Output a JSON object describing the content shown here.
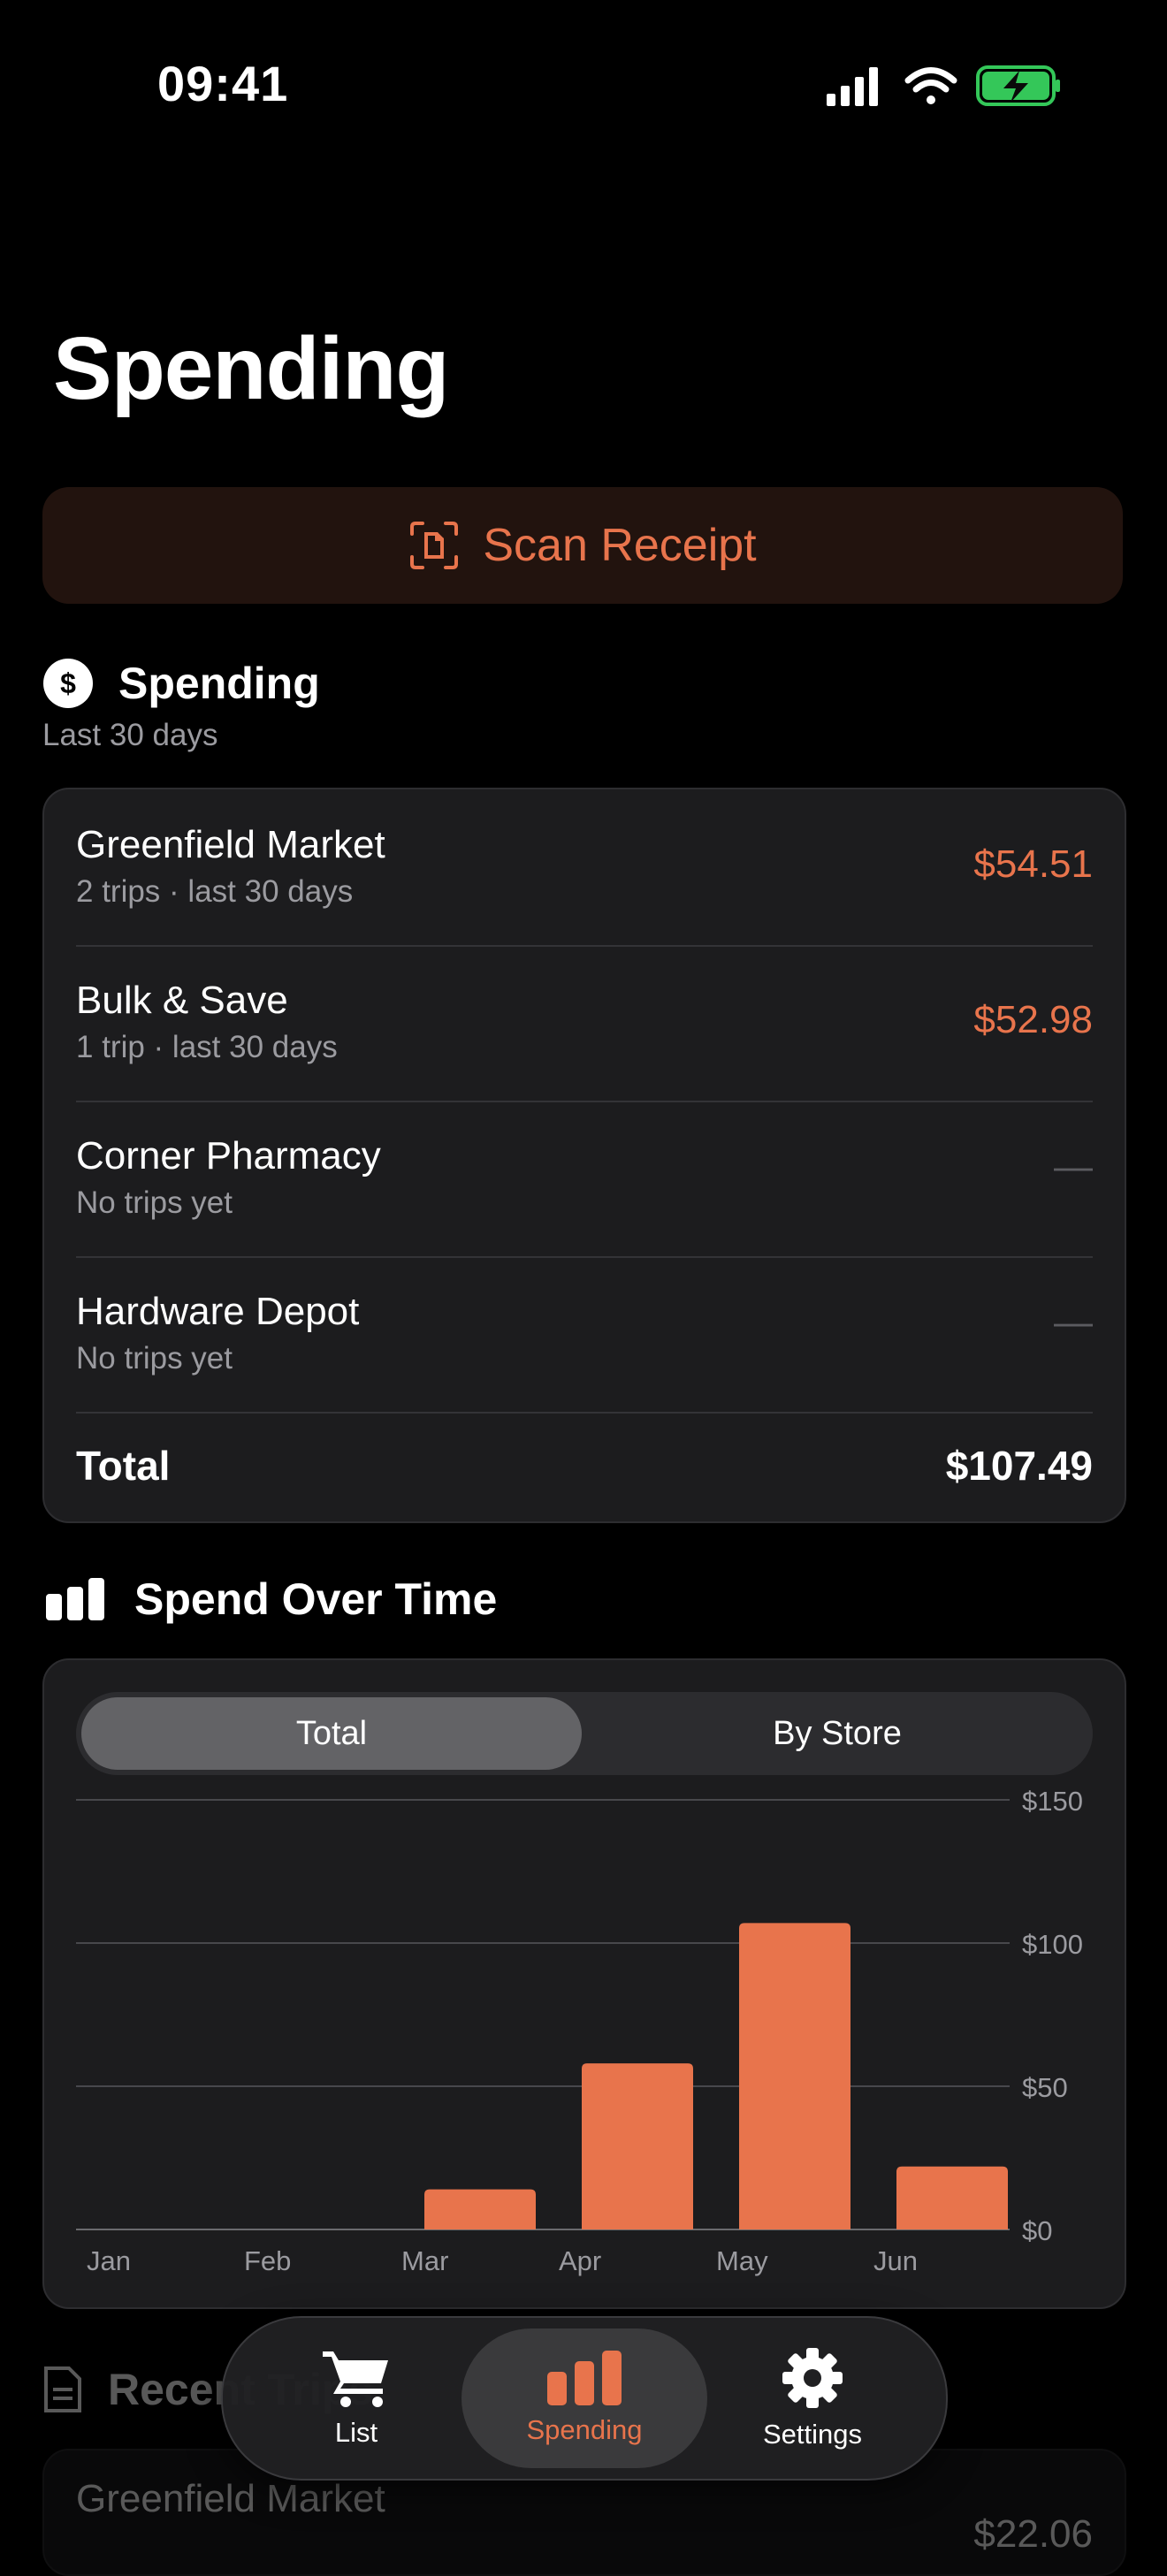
{
  "status_bar": {
    "time": "09:41"
  },
  "page": {
    "title": "Spending"
  },
  "scan": {
    "label": "Scan Receipt"
  },
  "spending_section": {
    "title": "Spending",
    "subtitle": "Last 30 days"
  },
  "stores": [
    {
      "name": "Greenfield Market",
      "meta": "2 trips · last 30 days",
      "amount": "$54.51"
    },
    {
      "name": "Bulk & Save",
      "meta": "1 trip · last 30 days",
      "amount": "$52.98"
    },
    {
      "name": "Corner Pharmacy",
      "meta": "No trips yet",
      "amount": "—"
    },
    {
      "name": "Hardware Depot",
      "meta": "No trips yet",
      "amount": "—"
    }
  ],
  "total": {
    "label": "Total",
    "amount": "$107.49"
  },
  "chart_section": {
    "title": "Spend Over Time",
    "segments": [
      {
        "label": "Total",
        "selected": true
      },
      {
        "label": "By Store",
        "selected": false
      }
    ]
  },
  "chart_data": {
    "type": "bar",
    "categories": [
      "Jan",
      "Feb",
      "Mar",
      "Apr",
      "May",
      "Jun"
    ],
    "values": [
      0,
      0,
      14,
      58,
      107,
      22
    ],
    "ylim": [
      0,
      150
    ],
    "yticks": [
      0,
      50,
      100,
      150
    ],
    "ytick_labels": [
      "$0",
      "$50",
      "$100",
      "$150"
    ],
    "grid": true,
    "bar_color": "#e8744c"
  },
  "recent_section": {
    "title": "Recent Trips",
    "first_item": {
      "name": "Greenfield Market",
      "amount": "$22.06"
    }
  },
  "tabbar": {
    "items": [
      {
        "label": "List",
        "icon": "cart-icon"
      },
      {
        "label": "Spending",
        "icon": "chart-icon",
        "active": true
      },
      {
        "label": "Settings",
        "icon": "gear-icon"
      }
    ]
  },
  "colors": {
    "accent": "#e8744c",
    "card": "#1c1c1e",
    "background": "#000000"
  }
}
